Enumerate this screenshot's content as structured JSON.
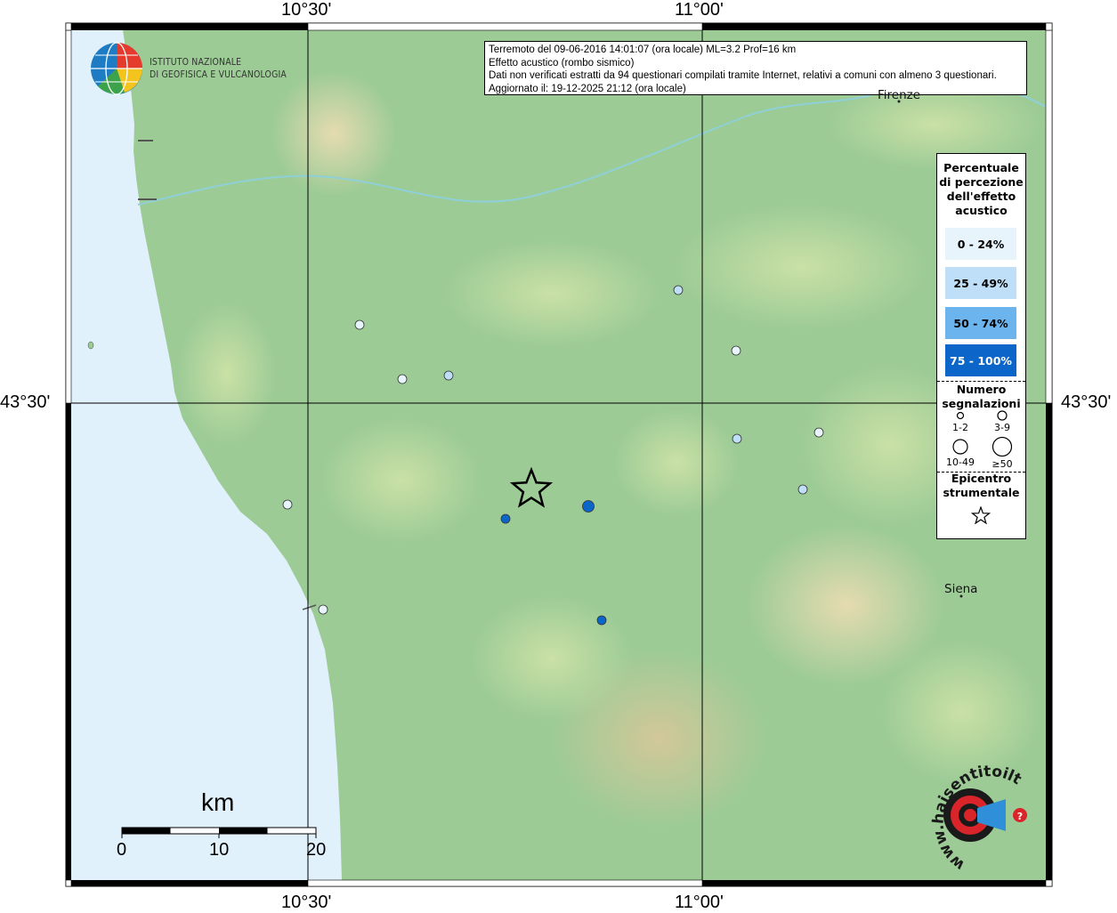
{
  "map": {
    "lon_top_labels": [
      "10°30'",
      "11°00'"
    ],
    "lon_bottom_labels": [
      "10°30'",
      "11°00'"
    ],
    "lat_left_label": "43°30'",
    "lat_right_label": "43°30'",
    "sea_color": "#e1f1fb",
    "land_color": "#9dcb96",
    "grid_color": "#000000"
  },
  "info": {
    "line1": "Terremoto del 09-06-2016 14:01:07 (ora locale) ML=3.2 Prof=16 km",
    "line2": "Effetto acustico (rombo sismico)",
    "line3": "Dati non verificati estratti da 94 questionari compilati tramite Internet, relativi a comuni con almeno 3 questionari.",
    "line4": "Aggiornato il: 19-12-2025 21:12 (ora locale)"
  },
  "org": {
    "line1": "ISTITUTO NAZIONALE",
    "line2": "DI GEOFISICA E VULCANOLOGIA"
  },
  "cities": [
    {
      "name": "Firenze"
    },
    {
      "name": "Siena"
    }
  ],
  "legend": {
    "title": [
      "Percentuale",
      "di percezione",
      "dell'effetto",
      "acustico"
    ],
    "classes": [
      {
        "label": "0 - 24%",
        "color": "#e8f4fc"
      },
      {
        "label": "25 - 49%",
        "color": "#bedff7"
      },
      {
        "label": "50 - 74%",
        "color": "#6cb4ee"
      },
      {
        "label": "75 - 100%",
        "color": "#0c65c8",
        "text_color": "#ffffff"
      }
    ],
    "count_title": [
      "Numero",
      "segnalazioni"
    ],
    "count_classes": [
      "1-2",
      "3-9",
      "10-49",
      "≥50"
    ],
    "epicenter_title": [
      "Epicentro",
      "strumentale"
    ]
  },
  "scale": {
    "unit": "km",
    "ticks": [
      "0",
      "10",
      "20"
    ]
  },
  "brand": {
    "text": "haisentitoilterremoto.it",
    "url": "www."
  },
  "points": [
    {
      "cls": 0,
      "size": "small"
    },
    {
      "cls": 0,
      "size": "small"
    },
    {
      "cls": 1,
      "size": "small"
    },
    {
      "cls": 1,
      "size": "small"
    },
    {
      "cls": 0,
      "size": "small"
    },
    {
      "cls": 1,
      "size": "small"
    },
    {
      "cls": 0,
      "size": "small"
    },
    {
      "cls": 1,
      "size": "small"
    },
    {
      "cls": 0,
      "size": "small"
    },
    {
      "cls": 3,
      "size": "small"
    },
    {
      "cls": 3,
      "size": "medium"
    },
    {
      "cls": 3,
      "size": "small"
    },
    {
      "cls": 0,
      "size": "small"
    }
  ]
}
